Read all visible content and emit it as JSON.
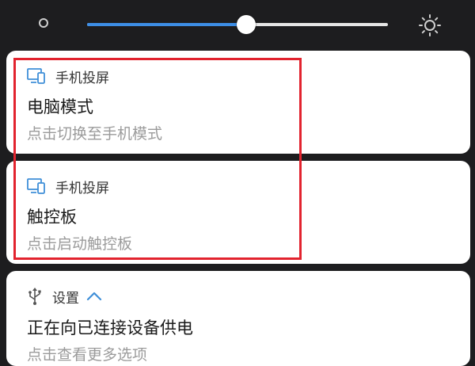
{
  "brightness": {
    "level": 0.53,
    "dim_icon": "brightness-low-icon",
    "bright_icon": "brightness-high-icon",
    "accent_color": "#3d8ee6"
  },
  "notifications": [
    {
      "app_label": "手机投屏",
      "icon": "screen-cast-icon",
      "title": "电脑模式",
      "subtitle": "点击切换至手机模式"
    },
    {
      "app_label": "手机投屏",
      "icon": "screen-cast-icon",
      "title": "触控板",
      "subtitle": "点击启动触控板"
    },
    {
      "app_label": "设置",
      "icon": "usb-icon",
      "expand_icon": "chevron-up-icon",
      "title": "正在向已连接设备供电",
      "subtitle": "点击查看更多选项"
    }
  ],
  "highlight_color": "#e2232e"
}
